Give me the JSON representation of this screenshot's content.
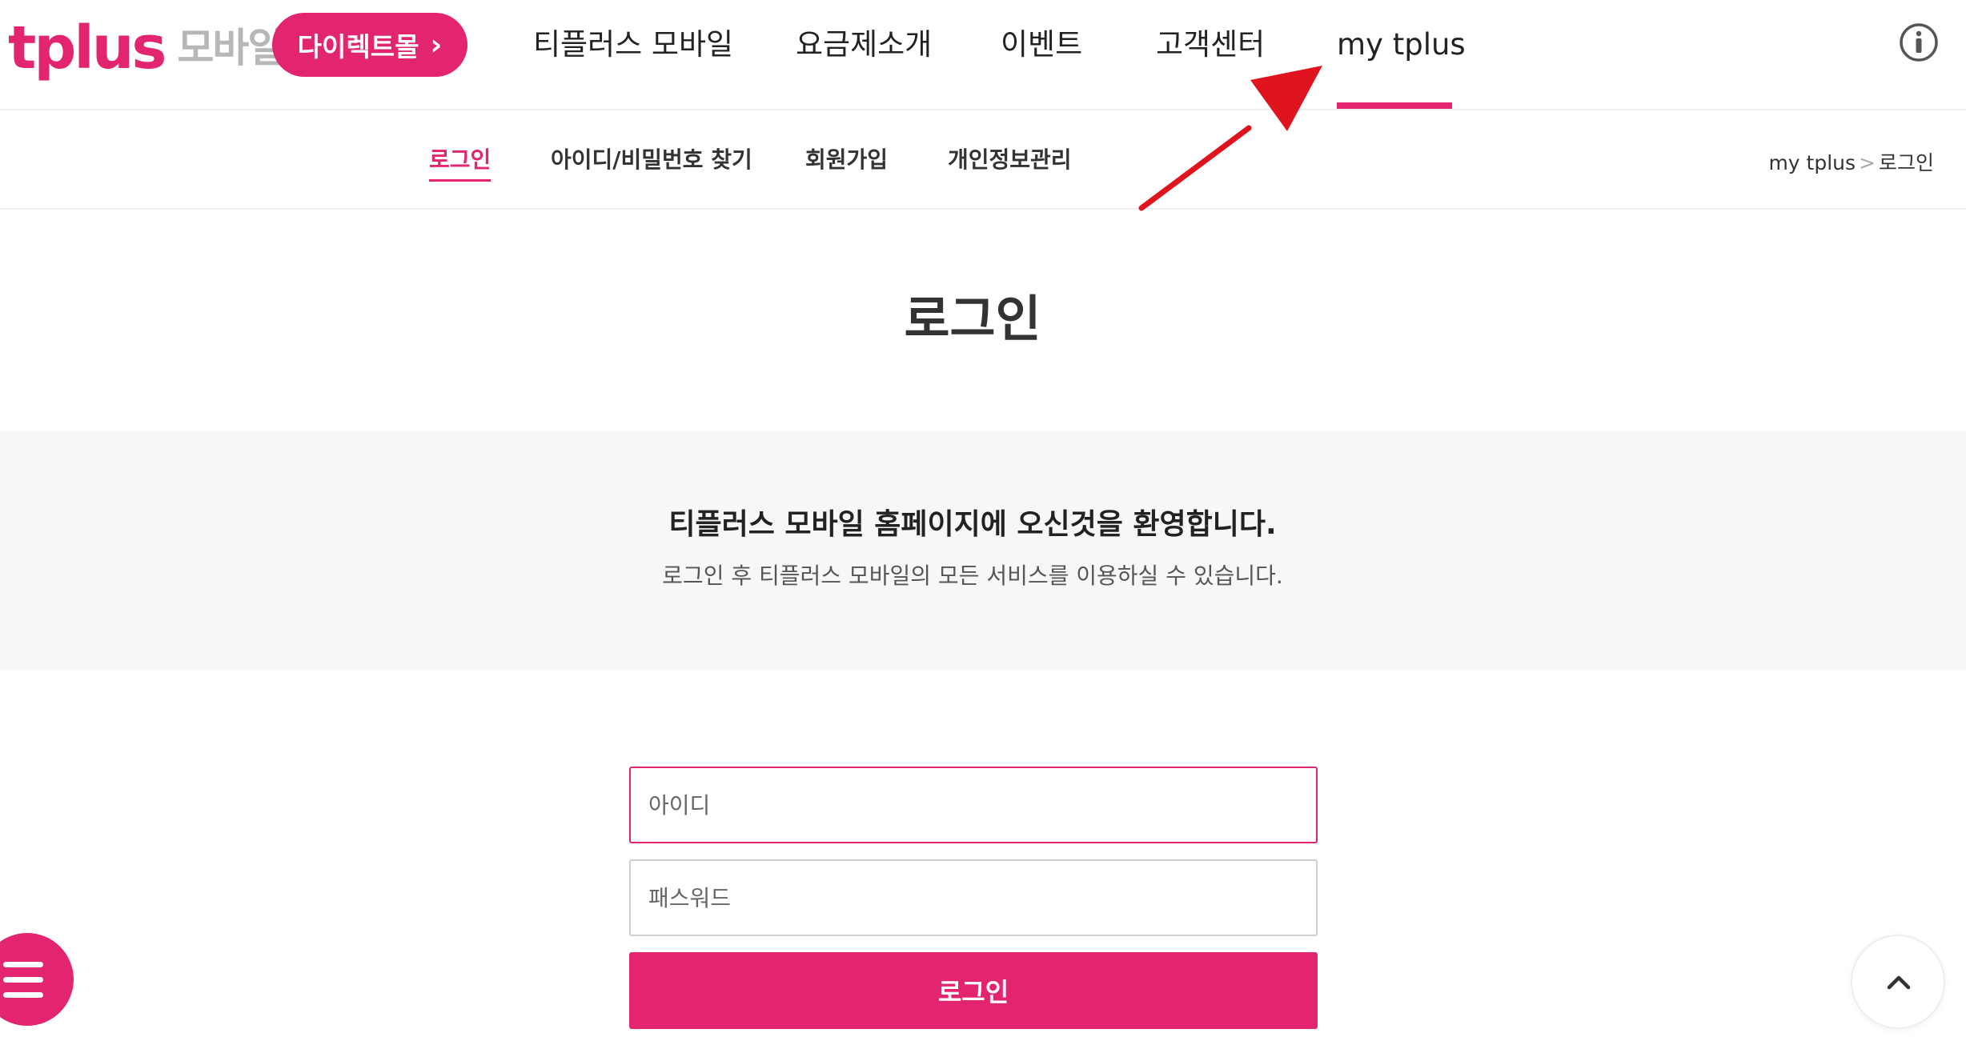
{
  "header": {
    "logo": {
      "brand": "tplus",
      "suffix": "모바일"
    },
    "direct_mall": {
      "label": "다이렉트몰",
      "chevron": "›"
    },
    "gnb": [
      {
        "label": "티플러스 모바일"
      },
      {
        "label": "요금제소개"
      },
      {
        "label": "이벤트"
      },
      {
        "label": "고객센터"
      },
      {
        "label": "my tplus",
        "active": true
      }
    ],
    "info_icon": "info-circle-icon"
  },
  "subnav": {
    "items": [
      {
        "label": "로그인",
        "active": true
      },
      {
        "label": "아이디/비밀번호 찾기"
      },
      {
        "label": "회원가입"
      },
      {
        "label": "개인정보관리"
      }
    ],
    "breadcrumb": {
      "parent": "my tplus",
      "separator": ">",
      "current": "로그인"
    }
  },
  "page": {
    "title": "로그인"
  },
  "welcome": {
    "title": "티플러스 모바일 홈페이지에 오신것을 환영합니다.",
    "subtitle": "로그인 후 티플러스 모바일의 모든 서비스를 이용하실 수 있습니다."
  },
  "login_form": {
    "id_field": {
      "value": "",
      "placeholder": "아이디"
    },
    "password_field": {
      "value": "",
      "placeholder": "패스워드"
    },
    "submit_label": "로그인"
  },
  "floating": {
    "menu_icon": "hamburger-menu-icon",
    "top_icon": "chevron-up-icon"
  },
  "colors": {
    "brand": "#e3256f",
    "logo_gray": "#b7b7b7",
    "band_bg": "#f7f7f7",
    "annotation_arrow": "#e0141e"
  }
}
